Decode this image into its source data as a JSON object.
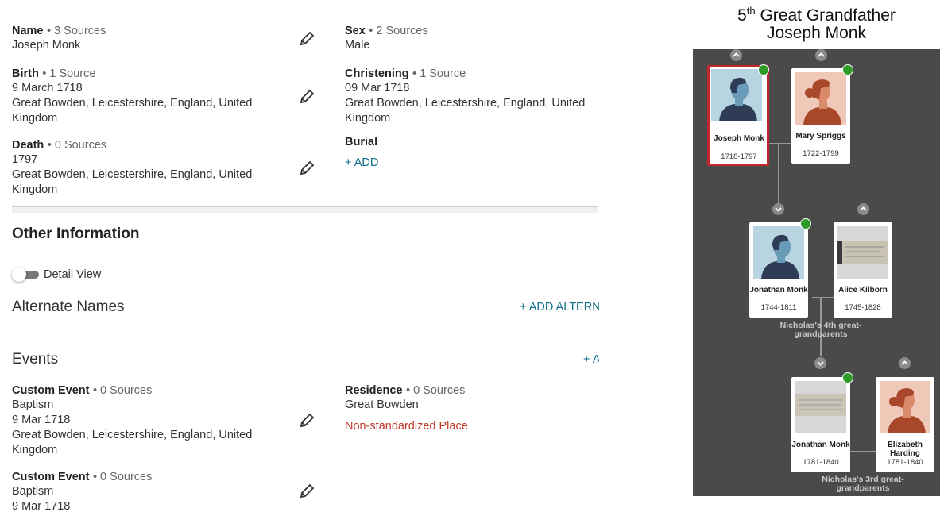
{
  "facts": {
    "name": {
      "label": "Name",
      "sources": "• 3 Sources",
      "value": "Joseph Monk"
    },
    "sex": {
      "label": "Sex",
      "sources": "• 2 Sources",
      "value": "Male"
    },
    "birth": {
      "label": "Birth",
      "sources": "• 1 Source",
      "date": "9 March 1718",
      "place": "Great Bowden, Leicestershire, England, United Kingdom"
    },
    "christening": {
      "label": "Christening",
      "sources": "• 1 Source",
      "date": "09 Mar 1718",
      "place": "Great Bowden, Leicestershire, England, United Kingdom"
    },
    "death": {
      "label": "Death",
      "sources": "• 0 Sources",
      "date": "1797",
      "place": "Great Bowden, Leicestershire, England, United Kingdom"
    },
    "burial": {
      "label": "Burial",
      "add": "+  ADD"
    }
  },
  "other": {
    "title": "Other Information",
    "toggle_label": "Detail View",
    "alternate_names": "Alternate Names",
    "add_alternate": "+  ADD ALTERN",
    "events": "Events",
    "add_event": "+  A"
  },
  "events": {
    "custom1": {
      "label": "Custom Event",
      "sources": "• 0 Sources",
      "type": "Baptism",
      "date": "9 Mar 1718",
      "place": "Great Bowden, Leicestershire, England, United Kingdom"
    },
    "residence": {
      "label": "Residence",
      "sources": "• 0 Sources",
      "place": "Great Bowden",
      "warning": "Non-standardized Place"
    },
    "custom2": {
      "label": "Custom Event",
      "sources": "• 0 Sources",
      "type": "Baptism",
      "date": "9 Mar 1718"
    }
  },
  "header": {
    "relation_prefix": "5",
    "relation_sup": "th",
    "relation_rest": " Great Grandfather",
    "person": "Joseph Monk"
  },
  "tree": {
    "cards": [
      {
        "name": "Joseph Monk",
        "dates": "1718-1797",
        "photo": "male-avatar"
      },
      {
        "name": "Mary Spriggs",
        "dates": "1722-1799",
        "photo": "female-avatar"
      },
      {
        "name": "Jonathan Monk",
        "dates": "1744-1811",
        "photo": "male-avatar"
      },
      {
        "name": "Alice Kilborn",
        "dates": "1745-1828",
        "photo": "document-photo"
      },
      {
        "name": "Jonathan Monk",
        "dates": "1781-1840",
        "photo": "document-photo"
      },
      {
        "name": "Elizabeth Harding",
        "dates": "1781-1840",
        "photo": "female-avatar"
      }
    ],
    "couple_labels": [
      "Nicholas's 4th great-grandparents",
      "Nicholas's 3rd great-grandparents"
    ],
    "colors": {
      "background": "#4a4a4a",
      "selected_border": "#c0282d",
      "badge": "#2e9a28",
      "female_bg": "#f0c8b8",
      "male_bg": "#b8d4e0"
    }
  }
}
